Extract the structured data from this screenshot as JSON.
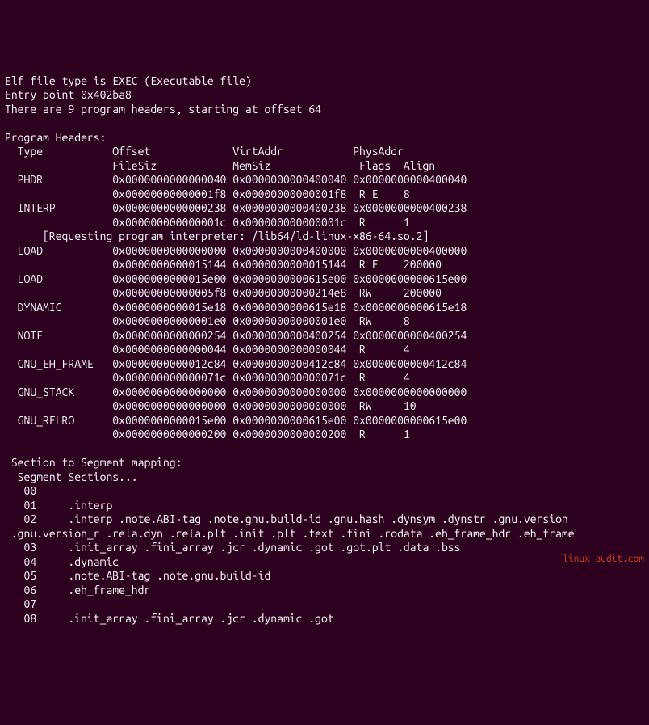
{
  "header": {
    "line1": "Elf file type is EXEC (Executable file)",
    "line2": "Entry point 0x402ba8",
    "line3": "There are 9 program headers, starting at offset 64"
  },
  "program_headers_title": "Program Headers:",
  "columns": {
    "row1": "  Type           Offset             VirtAddr           PhysAddr",
    "row2": "                 FileSiz            MemSiz              Flags  Align"
  },
  "entries": [
    {
      "l1": "  PHDR           0x0000000000000040 0x0000000000400040 0x0000000000400040",
      "l2": "                 0x00000000000001f8 0x00000000000001f8  R E    8"
    },
    {
      "l1": "  INTERP         0x0000000000000238 0x0000000000400238 0x0000000000400238",
      "l2": "                 0x000000000000001c 0x000000000000001c  R      1",
      "note": "      [Requesting program interpreter: /lib64/ld-linux-x86-64.so.2]"
    },
    {
      "l1": "  LOAD           0x0000000000000000 0x0000000000400000 0x0000000000400000",
      "l2": "                 0x0000000000015144 0x0000000000015144  R E    200000"
    },
    {
      "l1": "  LOAD           0x0000000000015e00 0x0000000000615e00 0x0000000000615e00",
      "l2": "                 0x00000000000005f8 0x00000000000214e8  RW     200000"
    },
    {
      "l1": "  DYNAMIC        0x0000000000015e18 0x0000000000615e18 0x0000000000615e18",
      "l2": "                 0x00000000000001e0 0x00000000000001e0  RW     8"
    },
    {
      "l1": "  NOTE           0x0000000000000254 0x0000000000400254 0x0000000000400254",
      "l2": "                 0x0000000000000044 0x0000000000000044  R      4"
    },
    {
      "l1": "  GNU_EH_FRAME   0x0000000000012c84 0x0000000000412c84 0x0000000000412c84",
      "l2": "                 0x000000000000071c 0x000000000000071c  R      4"
    },
    {
      "l1": "  GNU_STACK      0x0000000000000000 0x0000000000000000 0x0000000000000000",
      "l2": "                 0x0000000000000000 0x0000000000000000  RW     10"
    },
    {
      "l1": "  GNU_RELRO      0x0000000000015e00 0x0000000000615e00 0x0000000000615e00",
      "l2": "                 0x0000000000000200 0x0000000000000200  R      1"
    }
  ],
  "mapping": {
    "title": " Section to Segment mapping:",
    "subtitle": "  Segment Sections...",
    "rows": [
      "   00     ",
      "   01     .interp ",
      "   02     .interp .note.ABI-tag .note.gnu.build-id .gnu.hash .dynsym .dynstr .gnu.version",
      " .gnu.version_r .rela.dyn .rela.plt .init .plt .text .fini .rodata .eh_frame_hdr .eh_frame ",
      "   03     .init_array .fini_array .jcr .dynamic .got .got.plt .data .bss ",
      "   04     .dynamic ",
      "   05     .note.ABI-tag .note.gnu.build-id ",
      "   06     .eh_frame_hdr ",
      "   07     ",
      "   08     .init_array .fini_array .jcr .dynamic .got "
    ]
  },
  "watermark": "linux-audit.com"
}
